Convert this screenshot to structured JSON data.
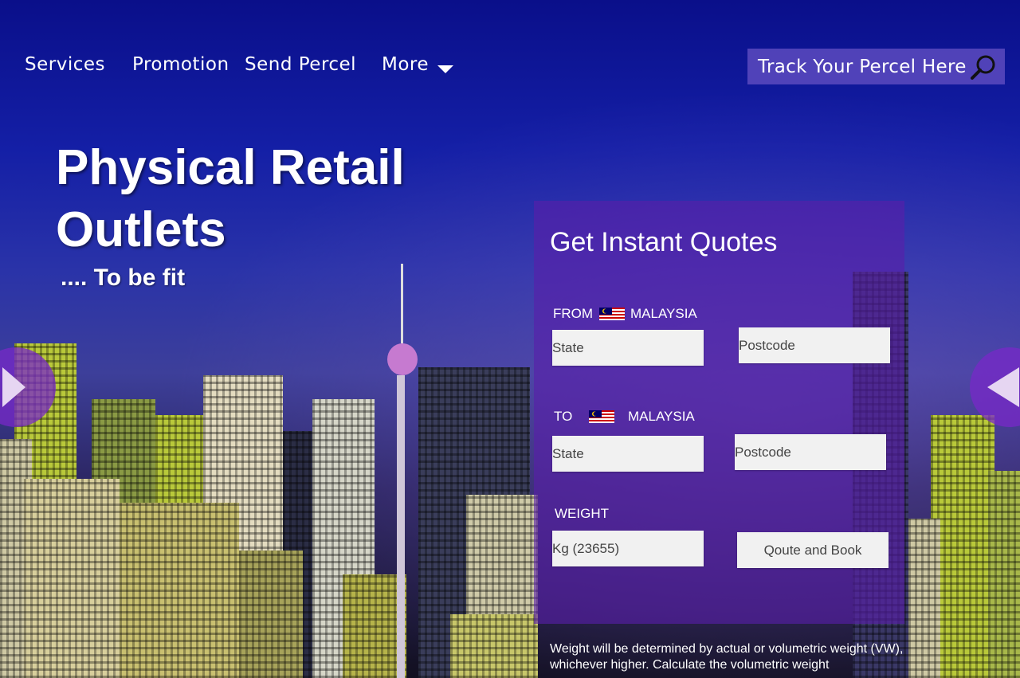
{
  "nav": {
    "items": [
      {
        "label": "Services"
      },
      {
        "label": "Promotion"
      },
      {
        "label": "Send Percel"
      },
      {
        "label": "More"
      }
    ],
    "more_icon": "chevron-down-icon",
    "track": {
      "label": "Track Your Percel Here",
      "icon": "search-icon"
    }
  },
  "hero": {
    "title_line1": "Physical Retail",
    "title_line2": "Outlets",
    "subtitle": ".... To be fit"
  },
  "carousel": {
    "prev_icon": "chevron-right-icon",
    "next_icon": "chevron-left-icon"
  },
  "quote": {
    "title": "Get Instant Quotes",
    "from": {
      "label": "FROM",
      "country": "MALAYSIA",
      "state_placeholder": "State",
      "postcode_placeholder": "Postcode"
    },
    "to": {
      "label": "TO",
      "country": "MALAYSIA",
      "state_placeholder": "State",
      "postcode_placeholder": "Postcode"
    },
    "weight": {
      "label": "WEIGHT",
      "placeholder": "Kg (23655)"
    },
    "submit_label": "Qoute and Book",
    "note": "Weight will be determined by actual or volumetric weight (VW), whichever higher. Calculate the volumetric weight"
  },
  "colors": {
    "sky_top": "#0a0f8a",
    "panel": "#581eaa",
    "track_bg": "#5c4abe",
    "arrow_bg": "#7828c8"
  }
}
